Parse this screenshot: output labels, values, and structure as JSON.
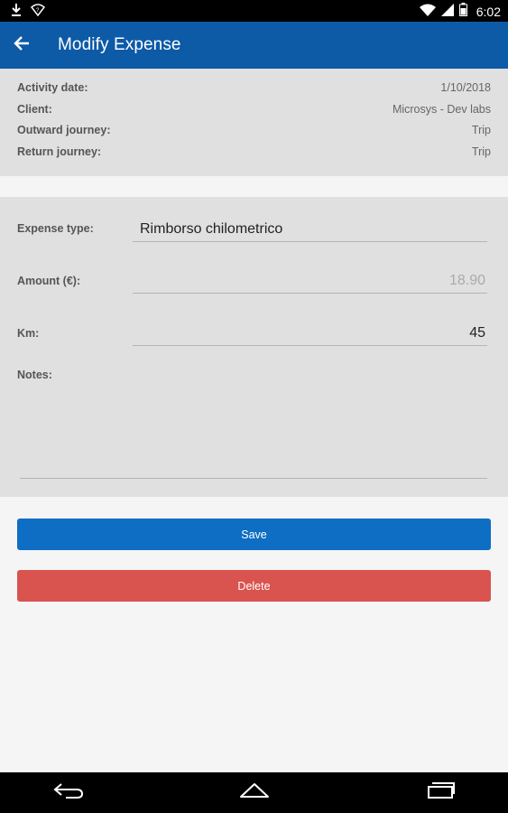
{
  "status_bar": {
    "time": "6:02",
    "icons": [
      "download-icon",
      "wifi-signal-icon",
      "wifi-icon",
      "battery-icon"
    ]
  },
  "app_bar": {
    "title": "Modify Expense",
    "back_icon": "arrow-back-icon",
    "color": "#0d5aa7"
  },
  "activity": {
    "rows": [
      {
        "label": "Activity date:",
        "value": "1/10/2018"
      },
      {
        "label": "Client:",
        "value": "Microsys - Dev labs"
      },
      {
        "label": "Outward journey:",
        "value": "Trip"
      },
      {
        "label": "Return journey:",
        "value": "Trip"
      }
    ]
  },
  "form": {
    "expense_type_label": "Expense type:",
    "expense_type_value": "Rimborso chilometrico",
    "amount_label": "Amount (€):",
    "amount_value": "18.90",
    "km_label": "Km:",
    "km_value": "45",
    "notes_label": "Notes:",
    "notes_value": ""
  },
  "actions": {
    "save_label": "Save",
    "delete_label": "Delete",
    "save_color": "#0d6ec4",
    "delete_color": "#d9534f"
  },
  "nav_bar": {
    "icons": [
      "back-nav-icon",
      "home-nav-icon",
      "recents-nav-icon"
    ]
  }
}
